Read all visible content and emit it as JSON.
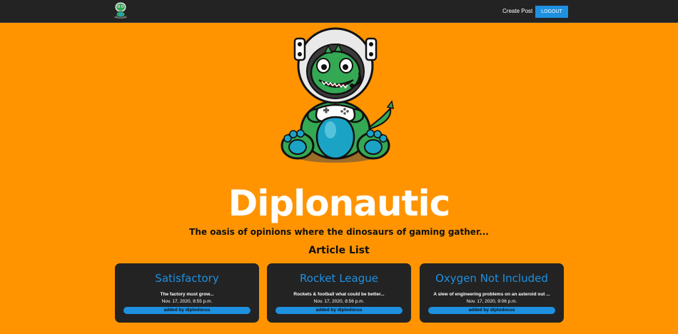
{
  "navbar": {
    "create_post_label": "Create Post",
    "logout_label": "LOGOUT"
  },
  "hero": {
    "title": "Diplonautic",
    "tagline": "The oasis of opinions where the dinosaurs of gaming gather..."
  },
  "articles": {
    "heading": "Article List",
    "items": [
      {
        "title": "Satisfactory",
        "description": "The factory must grow...",
        "date": "Nov. 17, 2020, 8:55 p.m.",
        "author": "added by diplodocus"
      },
      {
        "title": "Rocket League",
        "description": "Rockets & football what could be better...",
        "date": "Nov. 17, 2020, 8:56 p.m.",
        "author": "added by diplodocus"
      },
      {
        "title": "Oxygen Not Included",
        "description": "A slew of engineering problems on an asteroid out ...",
        "date": "Nov. 17, 2020, 9:06 p.m.",
        "author": "added by diplodocus"
      }
    ]
  },
  "colors": {
    "background": "#ff9400",
    "navbar": "#232323",
    "accent": "#1e90e0",
    "card": "#232323"
  },
  "icons": {
    "logo": "astronaut-dinosaur-logo",
    "hero": "astronaut-dinosaur-with-gamepad"
  }
}
